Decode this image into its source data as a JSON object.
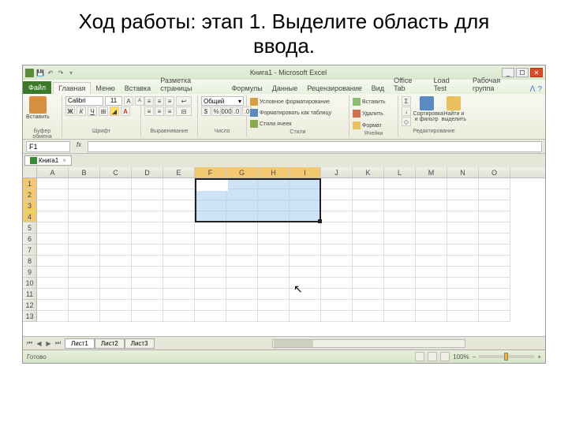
{
  "slide": {
    "title": "Ход работы: этап 1. Выделите область для ввода."
  },
  "window": {
    "title": "Книга1 - Microsoft Excel",
    "min": "_",
    "max": "☐",
    "close": "✕"
  },
  "tabs": {
    "file": "Файл",
    "items": [
      "Главная",
      "Меню",
      "Вставка",
      "Разметка страницы",
      "Формулы",
      "Данные",
      "Рецензирование",
      "Вид",
      "Office Tab",
      "Load Test",
      "Рабочая группа"
    ]
  },
  "ribbon": {
    "clipboard": {
      "paste": "Вставить",
      "label": "Буфер обмена"
    },
    "font": {
      "name": "Calibri",
      "size": "11",
      "bold": "Ж",
      "italic": "К",
      "underline": "Ч",
      "label": "Шрифт"
    },
    "align": {
      "label": "Выравнивание"
    },
    "number": {
      "format": "Общий",
      "label": "Число"
    },
    "styles": {
      "cond": "Условное форматирование",
      "table": "Форматировать как таблицу",
      "cell": "Стили ячеек",
      "label": "Стили"
    },
    "cells": {
      "insert": "Вставить",
      "delete": "Удалить",
      "format": "Формат",
      "label": "Ячейки"
    },
    "editing": {
      "sort": "Сортировка и фильтр",
      "find": "Найти и выделить",
      "label": "Редактирование"
    }
  },
  "nameBox": "F1",
  "fx": "fx",
  "wbTab": {
    "name": "Книга1",
    "close": "×"
  },
  "cols": [
    "A",
    "B",
    "C",
    "D",
    "E",
    "F",
    "G",
    "H",
    "I",
    "J",
    "K",
    "L",
    "M",
    "N",
    "O"
  ],
  "rows": [
    "1",
    "2",
    "3",
    "4",
    "5",
    "6",
    "7",
    "8",
    "9",
    "10",
    "11",
    "12",
    "13"
  ],
  "selection": {
    "colStart": 5,
    "colEnd": 8,
    "rowStart": 0,
    "rowEnd": 3
  },
  "sheets": {
    "active": "Лист1",
    "others": [
      "Лист2",
      "Лист3"
    ]
  },
  "status": {
    "mode": "Готово",
    "zoom": "100%",
    "minus": "−",
    "plus": "+"
  }
}
